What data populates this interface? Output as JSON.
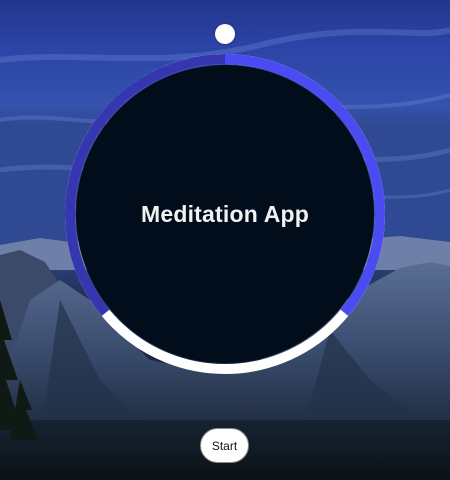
{
  "app": {
    "title": "Meditation App"
  },
  "controls": {
    "start_label": "Start"
  },
  "timer": {
    "progress_fraction": 0.36
  },
  "background": {
    "description_icon": "mountain-night-sky"
  },
  "colors": {
    "ring_progress": "#4a4cf2",
    "ring_track": "#3536b0",
    "ring_remaining": "#ffffff",
    "face": "#010d1a",
    "title_text": "#f2f2f2"
  }
}
